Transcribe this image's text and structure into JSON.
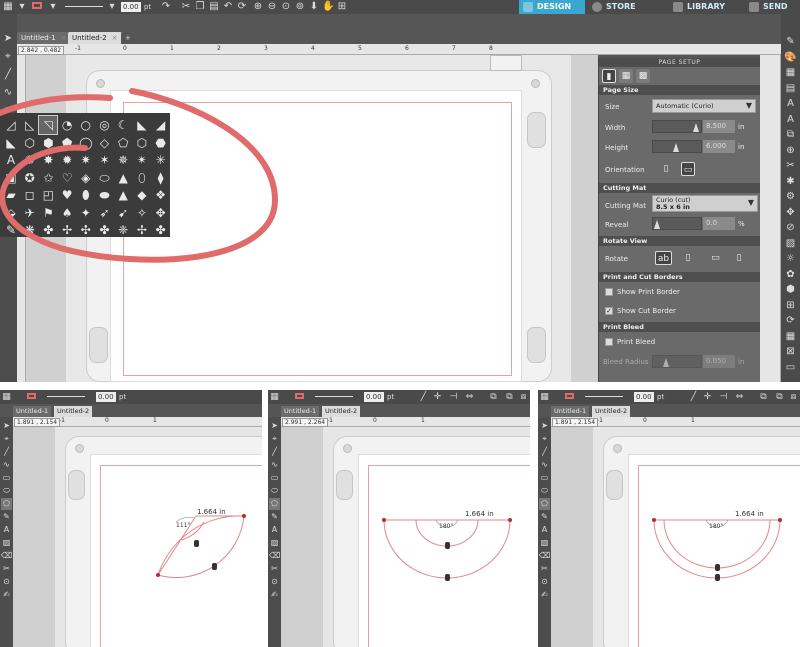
{
  "main": {
    "toolbar": {
      "line_width_value": "0.00",
      "line_width_unit": "pt"
    },
    "nav_tabs": [
      {
        "label": "DESIGN",
        "icon": "grid-icon",
        "color": "#3aa7cf"
      },
      {
        "label": "STORE",
        "icon": "globe-icon",
        "color": "#5ab0d1"
      },
      {
        "label": "LIBRARY",
        "icon": "library-icon",
        "color": "#5ab0d1"
      },
      {
        "label": "SEND",
        "icon": "send-icon",
        "color": "#5ab0d1"
      }
    ],
    "doc_tabs": [
      {
        "label": "Untitled-1"
      },
      {
        "label": "Untitled-2"
      }
    ],
    "new_tab": "+",
    "coord_readout": "2.842 , 0.482",
    "ruler_labels": [
      "-1",
      "0",
      "1",
      "2",
      "3",
      "4",
      "5",
      "6",
      "7",
      "8"
    ],
    "annotation_color": "#e06b6b"
  },
  "page_setup": {
    "title": "PAGE SETUP",
    "page_size": {
      "header": "Page Size",
      "size_label": "Size",
      "size_value": "Automatic (Curio)",
      "width_label": "Width",
      "width_value": "8.500",
      "height_label": "Height",
      "height_value": "6.000",
      "unit": "in",
      "orientation_label": "Orientation"
    },
    "cutting_mat": {
      "header": "Cutting Mat",
      "label": "Cutting Mat",
      "value_line1": "Curio (cut)",
      "value_line2": "8.5 x 6 in",
      "reveal_label": "Reveal",
      "reveal_value": "0.0",
      "reveal_unit": "%"
    },
    "rotate_view": {
      "header": "Rotate View",
      "label": "Rotate"
    },
    "borders": {
      "header": "Print and Cut Borders",
      "show_print_border": "Show Print Border",
      "show_cut_border": "Show Cut Border",
      "show_cut_border_checked": true
    },
    "print_bleed": {
      "header": "Print Bleed",
      "label": "Print Bleed",
      "radius_label": "Bleed Radius",
      "radius_value": "0.050",
      "unit": "in"
    }
  },
  "bottom_panels": [
    {
      "doc_tabs": [
        "Untitled-1",
        "Untitled-2"
      ],
      "coord_readout": "1.891 , 2.154",
      "line_width_value": "0.00",
      "line_width_unit": "pt",
      "ruler_labels": [
        "-1",
        "0",
        "1"
      ],
      "dimension_label": "1.664 in",
      "angle_label": "111°"
    },
    {
      "doc_tabs": [
        "Untitled-1",
        "Untitled-2"
      ],
      "coord_readout": "2.991 , 2.264",
      "line_width_value": "0.00",
      "line_width_unit": "pt",
      "ruler_labels": [
        "-1",
        "0",
        "1"
      ],
      "dimension_label": "1.664 in",
      "angle_label": "180°"
    },
    {
      "doc_tabs": [
        "Untitled-1",
        "Untitled-2"
      ],
      "coord_readout": "1.891 , 2.154",
      "line_width_value": "0.00",
      "line_width_unit": "pt",
      "ruler_labels": [
        "-1",
        "0",
        "1"
      ],
      "dimension_label": "1.664 in",
      "angle_label": "180°"
    }
  ]
}
